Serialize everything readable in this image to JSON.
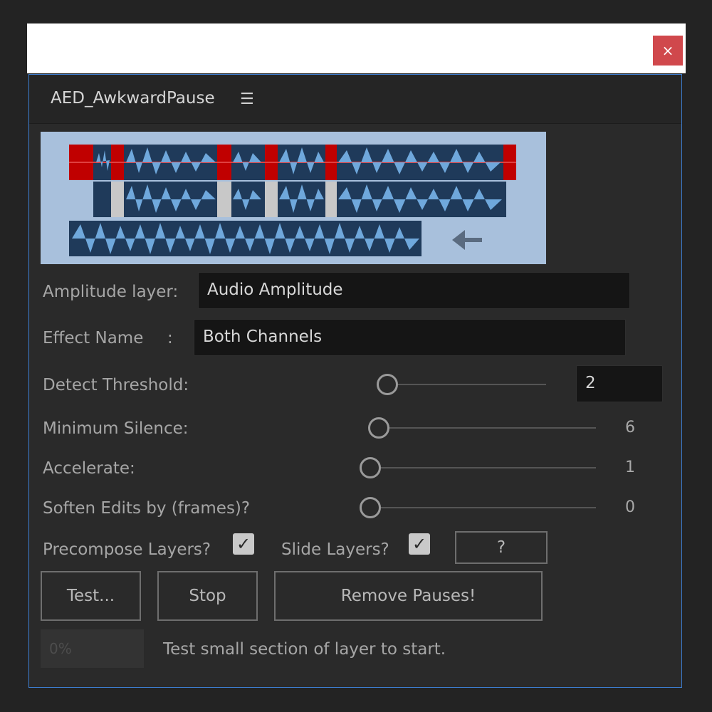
{
  "window": {
    "close_label": "×"
  },
  "panel": {
    "title": "AED_AwkwardPause",
    "menu_glyph": "☰"
  },
  "fields": {
    "amplitude_label": "Amplitude layer:",
    "amplitude_value": "Audio Amplitude",
    "effect_label": "Effect Name",
    "effect_colon": ":",
    "effect_value": "Both Channels"
  },
  "sliders": {
    "threshold": {
      "label": "Detect Threshold:",
      "value": "2"
    },
    "min_silence": {
      "label": "Minimum Silence:",
      "value": "6"
    },
    "accelerate": {
      "label": "Accelerate:",
      "value": "1"
    },
    "soften": {
      "label": "Soften Edits by (frames)?",
      "value": "0"
    }
  },
  "options": {
    "precompose_label": "Precompose Layers?",
    "precompose_checked": true,
    "slide_label": "Slide Layers?",
    "slide_checked": true,
    "check_glyph": "✓",
    "help_label": "?"
  },
  "buttons": {
    "test": "Test...",
    "stop": "Stop",
    "remove": "Remove Pauses!"
  },
  "status": {
    "progress": "0%",
    "message": "Test small section of layer to start."
  },
  "colors": {
    "accent_border": "#3d7ed1",
    "close_red": "#d0484c",
    "wave_blue": "#6fa8dc",
    "silence_red": "#c00000"
  }
}
